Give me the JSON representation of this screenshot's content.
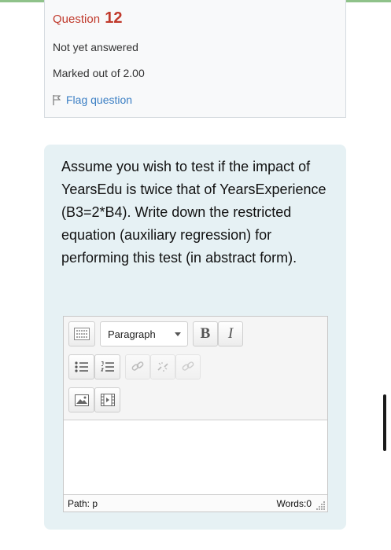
{
  "question": {
    "title_prefix": "Question",
    "number": "12",
    "state": "Not yet answered",
    "grade": "Marked out of 2.00",
    "flag_label": "Flag question",
    "text": "Assume you wish to test if the impact of YearsEdu is twice that of YearsExperience (B3=2*B4). Write down the restricted equation (auxiliary regression) for performing this test (in abstract form)."
  },
  "editor": {
    "format_select": "Paragraph",
    "bold_label": "B",
    "italic_label": "I",
    "content": "",
    "status_path": "Path: p",
    "status_words": "Words:0"
  },
  "colors": {
    "accent_red": "#c0392b",
    "link_blue": "#3b7fc4",
    "question_bg": "#e6f1f4",
    "info_bg": "#f8f9fa"
  },
  "icons": [
    "flag-icon",
    "toolbar-toggle-icon",
    "bullet-list-icon",
    "numbered-list-icon",
    "link-icon",
    "unlink-icon",
    "anchor-icon",
    "image-icon",
    "media-icon",
    "resize-handle-icon"
  ]
}
